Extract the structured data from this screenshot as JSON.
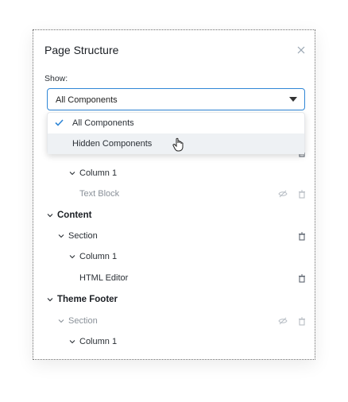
{
  "panel": {
    "title": "Page Structure",
    "show_label": "Show:",
    "select_value": "All Components"
  },
  "dropdown": {
    "options": [
      {
        "label": "All Components",
        "selected": true
      },
      {
        "label": "Hidden Components",
        "selected": false
      }
    ]
  },
  "tree": [
    {
      "label": "Column 1",
      "level": 2,
      "style": "normal",
      "expand": true
    },
    {
      "label": "Text Block",
      "level": 3,
      "style": "muted",
      "hidden_icon": true
    },
    {
      "label": "Content",
      "level": 0,
      "style": "bold",
      "expand": true
    },
    {
      "label": "Section",
      "level": 1,
      "style": "normal",
      "expand": true
    },
    {
      "label": "Column 1",
      "level": 2,
      "style": "normal",
      "expand": true
    },
    {
      "label": "HTML Editor",
      "level": 3,
      "style": "normal"
    },
    {
      "label": "Theme Footer",
      "level": 0,
      "style": "bold",
      "expand": true
    },
    {
      "label": "Section",
      "level": 1,
      "style": "muted",
      "expand": true,
      "hidden_icon": true
    },
    {
      "label": "Column 1",
      "level": 2,
      "style": "normal",
      "expand": true
    }
  ],
  "colors": {
    "accent": "#2f86d6",
    "muted_text": "#8a9199",
    "hover_bg": "#eef1f4"
  },
  "icons": [
    "close-icon",
    "caret-down-icon",
    "check-icon",
    "chevron-down-icon",
    "eye-slash-icon",
    "trash-icon",
    "hand-cursor-icon"
  ]
}
